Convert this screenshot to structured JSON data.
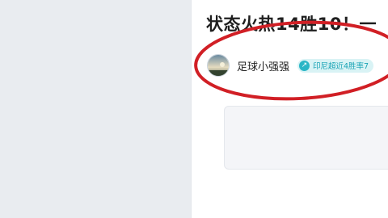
{
  "article": {
    "title": "状态火热14胜10！一",
    "author": {
      "name": "足球小强强",
      "badge": "印尼超近4胜率7"
    }
  },
  "colors": {
    "annotation": "#d11f25",
    "badge_text": "#18a3b5",
    "sidebar_bg": "#e9ecf0"
  },
  "icons": {
    "badge_icon": "up-arrow-icon",
    "avatar": "avatar-image"
  }
}
